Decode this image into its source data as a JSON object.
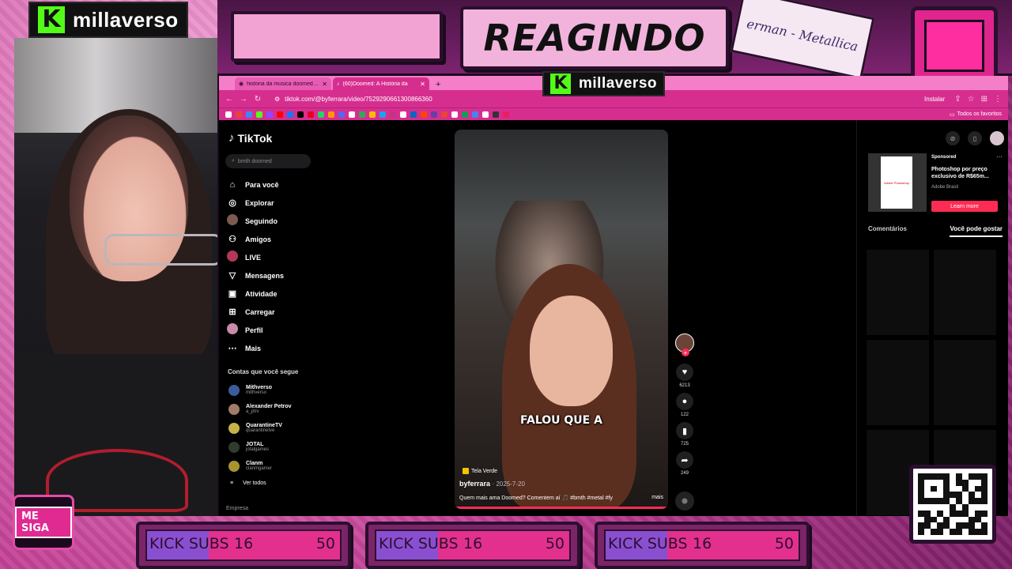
{
  "overlay": {
    "brand": "millaverso",
    "title": "REAGINDO",
    "song_note": "erman - Metallica",
    "me_siga": "ME SIGA",
    "colors": {
      "accent": "#e3308f",
      "kick_green": "#53fc18",
      "tiktok_red": "#fe2c55"
    },
    "sub_goals": [
      {
        "label": "KICK SUBS",
        "current": "16",
        "goal": "50",
        "progress": 0.32
      },
      {
        "label": "KICK SUBS",
        "current": "16",
        "goal": "50",
        "progress": 0.32
      },
      {
        "label": "KICK SUBS",
        "current": "16",
        "goal": "50",
        "progress": 0.32
      }
    ]
  },
  "browser": {
    "tabs": [
      {
        "title": "historia da musica doomed bm",
        "active": false
      },
      {
        "title": "(60)Doomed: A História da",
        "active": true
      }
    ],
    "url": "tiktok.com/@byferrara/video/7529290661300866360",
    "install_label": "Instalar",
    "all_bookmarks": "Todos os favoritos"
  },
  "tiktok": {
    "logo": "TikTok",
    "search_placeholder": "bmth doomed",
    "nav": [
      {
        "label": "Para você",
        "icon": "home-icon"
      },
      {
        "label": "Explorar",
        "icon": "compass-icon"
      },
      {
        "label": "Seguindo",
        "icon": "following-avatar"
      },
      {
        "label": "Amigos",
        "icon": "friends-icon"
      },
      {
        "label": "LIVE",
        "icon": "live-icon"
      },
      {
        "label": "Mensagens",
        "icon": "messages-icon"
      },
      {
        "label": "Atividade",
        "icon": "activity-icon"
      },
      {
        "label": "Carregar",
        "icon": "upload-icon"
      },
      {
        "label": "Perfil",
        "icon": "profile-icon"
      },
      {
        "label": "Mais",
        "icon": "more-icon"
      }
    ],
    "following_title": "Contas que você segue",
    "following": [
      {
        "name": "Mithverso",
        "handle": "mithverso"
      },
      {
        "name": "Alexander Petrov",
        "handle": "a_ptrv"
      },
      {
        "name": "QuarantineTV",
        "handle": "quarantinetve"
      },
      {
        "name": "JOTAL",
        "handle": "jotalgames"
      },
      {
        "name": "Clanm",
        "handle": "clanmgamer"
      }
    ],
    "see_all": "Ver todos",
    "footer": "Empresa",
    "video": {
      "caption": "FALOU QUE A",
      "effect": "Tela Verde",
      "author": "byferrara",
      "date": "2025-7-20",
      "description": "Quem mais ama Doomed? Comentem aí 🎵 #bmth #metal #fy",
      "more": "mais"
    },
    "stats": {
      "likes": "6213",
      "comments": "122",
      "saves": "725",
      "shares": "249"
    },
    "ad": {
      "sponsored": "Sponsored",
      "title": "Photoshop por preço exclusivo de R$65m...",
      "brand": "Adobe Brasil",
      "cta": "Learn more",
      "thumb_text": "Adobe Photoshop"
    },
    "right_tabs": {
      "comments": "Comentários",
      "suggested": "Você pode gostar"
    }
  }
}
